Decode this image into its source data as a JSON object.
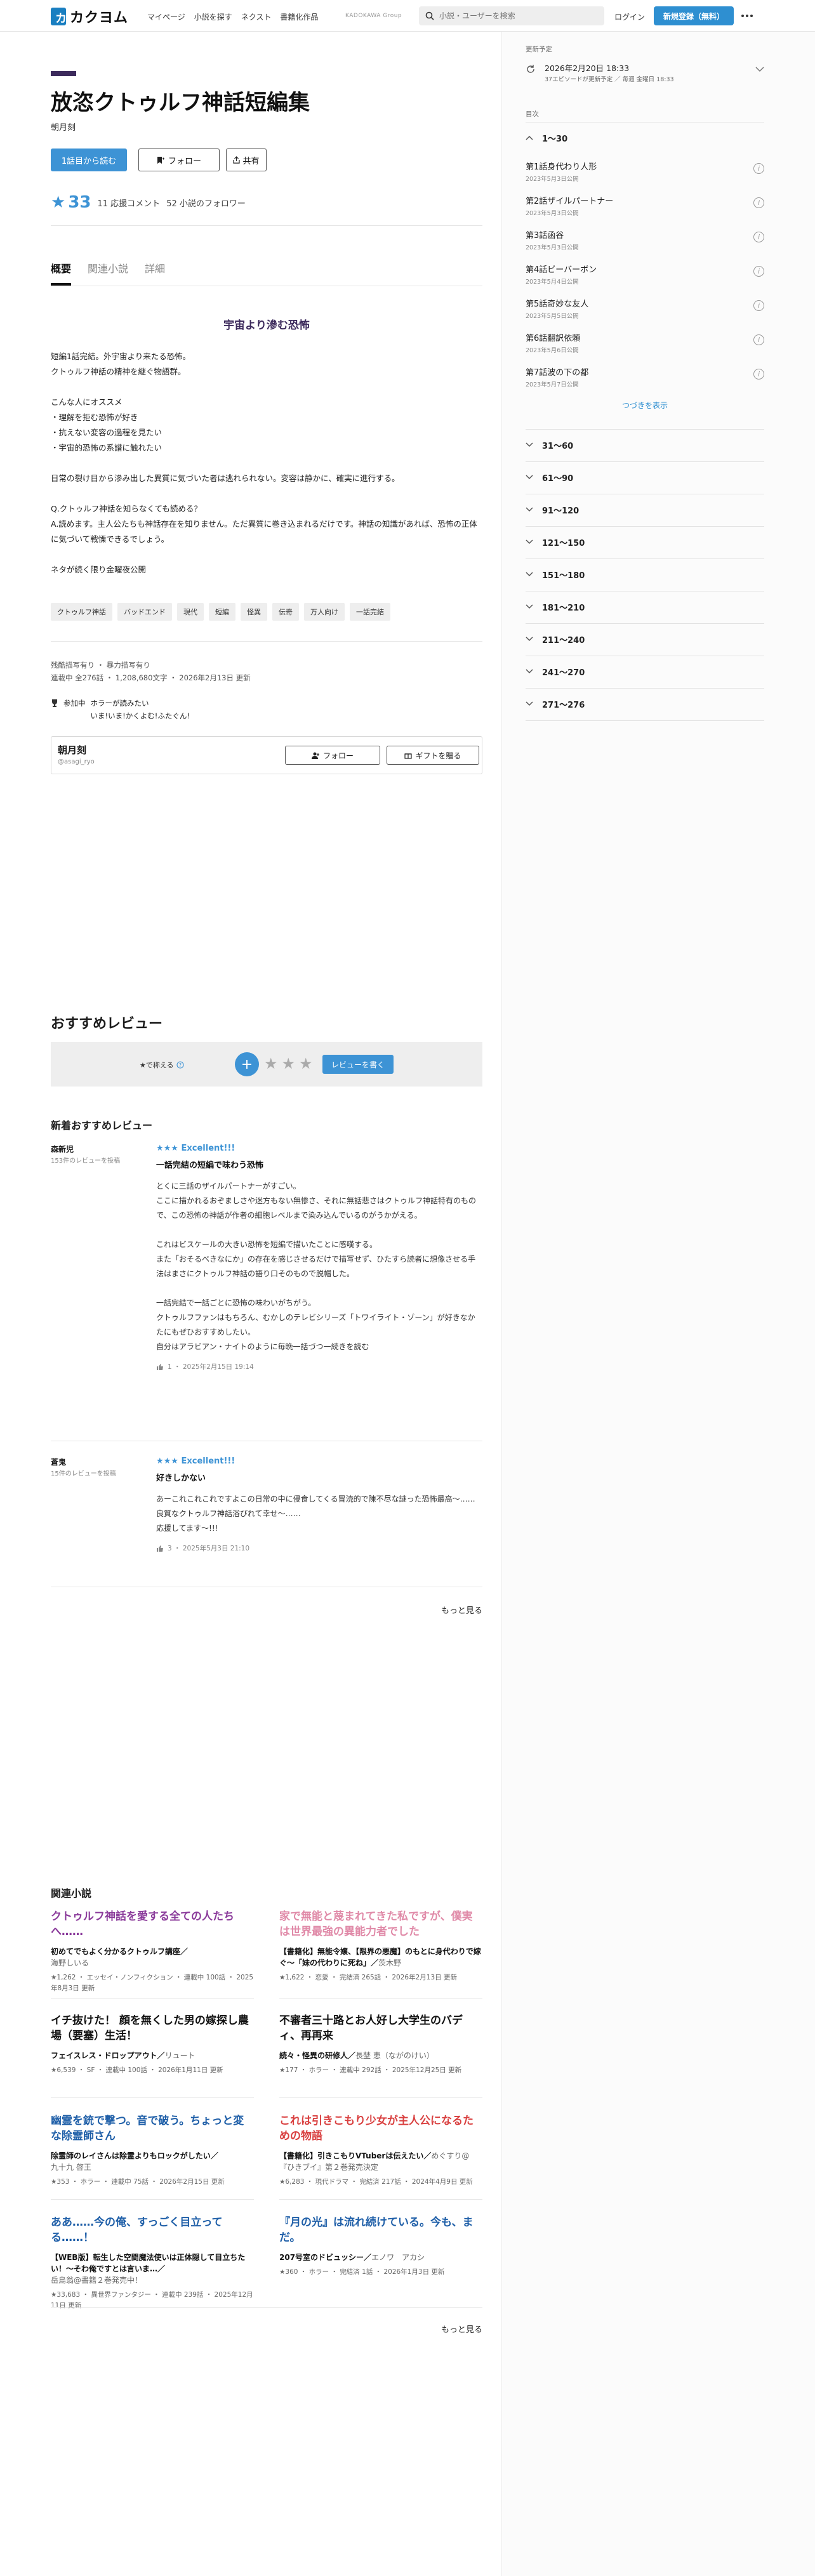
{
  "header": {
    "logo_glyph": "カ",
    "logo_text": "カクヨム",
    "nav": [
      "マイページ",
      "小説を探す",
      "ネクスト",
      "書籍化作品"
    ],
    "powered": "KADOKAWA Group",
    "search_placeholder": "小説・ユーザーを検索",
    "login": "ログイン",
    "signup": "新規登録（無料）"
  },
  "work": {
    "title": "放恣クトゥルフ神話短編集",
    "author": "朝月刻",
    "read_button": "1話目から読む",
    "follow_button": "フォロー",
    "share_button": "共有",
    "stars": "33",
    "cheer_comments": "11 応援コメント",
    "followers": "52 小説のフォロワー",
    "tabs": [
      "概要",
      "関連小説",
      "詳細"
    ],
    "catchphrase": "宇宙より滲む恐怖",
    "intro_paragraphs": [
      "短編1話完結。外宇宙より来たる恐怖。\nクトゥルフ神話の精神を継ぐ物語群。",
      "こんな人にオススメ\n・理解を拒む恐怖が好き\n・抗えない変容の過程を見たい\n・宇宙的恐怖の系譜に触れたい",
      "日常の裂け目から滲み出した異質に気づいた者は逃れられない。変容は静かに、確実に進行する。",
      "Q.クトゥルフ神話を知らなくても読める？\nA.読めます。主人公たちも神話存在を知りません。ただ異質に巻き込まれるだけです。神話の知識があれば、恐怖の正体に気づいて戦慄できるでしょう。",
      "ネタが続く限り金曜夜公開"
    ],
    "tags": [
      "クトゥルフ神話",
      "バッドエンド",
      "現代",
      "短編",
      "怪異",
      "伝奇",
      "万人向け",
      "一話完結"
    ],
    "meta_line1": "残酷描写有り ・ 暴力描写有り",
    "meta_line2": "連載中 全276話 ・ 1,208,680文字 ・ 2026年2月13日 更新",
    "contest_label": "参加中",
    "contest_lines": [
      "ホラーが読みたい",
      "いま!いま!かくよむ!ふたぐん!"
    ],
    "author_card": {
      "name": "朝月刻",
      "id": "@asagi_ryo",
      "follow": "フォロー",
      "gift": "ギフトを贈る"
    }
  },
  "reviews": {
    "section_title": "おすすめレビュー",
    "rate_label": "★で称える",
    "plus": "+",
    "empty_stars": "★★★",
    "write_button": "レビューを書く",
    "new_title": "新着おすすめレビュー",
    "items": [
      {
        "user": "森新児",
        "count": "153件のレビューを投稿",
        "rating": "★★★ Excellent!!!",
        "headline": "一話完結の短編で味わう恐怖",
        "text": "とくに三話のザイルパートナーがすごい。\nここに描かれるおぞましさや迷方もない無惨さ、それに無話悲さはクトゥルフ神話特有のもので、この恐怖の神話が作者の細胞レベルまで染み込んでいるのがうかがえる。\n\nこれはビスケールの大きい恐怖を短編で描いたことに感嘆する。\nまた「おそるべきなにか」の存在を感じさせるだけで描写せず、ひたすら読者に想像させる手法はまさにクトゥルフ神話の語り口そのもので脱帽した。\n\n一話完結で一話ごとに恐怖の味わいがちがう。\nクトゥルフファンはもちろん、むかしのテレビシリーズ「トワイライト・ゾーン」が好きなかたにもぜひおすすめしたい。\n自分はアラビアン・ナイトのように毎晩一話づつ一続きを読む",
        "footer": "1 ・ 2025年2月15日 19:14"
      },
      {
        "user": "蒼鬼",
        "count": "15件のレビューを投稿",
        "rating": "★★★ Excellent!!!",
        "headline": "好きしかない",
        "text": "あーこれこれこれですよこの日常の中に侵食してくる冒涜的で陳不尽な謎った恐怖最高〜……良質なクトゥルフ神話浴びれて幸せ〜……\n応援してます〜!!!",
        "footer": "3 ・ 2025年5月3日 21:10"
      }
    ],
    "more": "もっと見る"
  },
  "related": {
    "section_title": "関連小説",
    "items": [
      {
        "title": "クトゥルフ神話を愛する全ての人たちへ……",
        "color": "#8a3a9a",
        "catch": "初めてでもよく分かるクトゥルフ講座",
        "by": "海野しいる",
        "meta": "★1,262 ・ エッセイ・ノンフィクション ・ 連載中 100話 ・ 2025年8月3日 更新"
      },
      {
        "title": "家で無能と蔑まれてきた私ですが、僕実は世界最強の異能力者でした",
        "color": "#e08aa8",
        "catch": "【書籍化】無能令嬢、【限界の悪魔】のもとに身代わりで嫁ぐ〜「妹の代わりに死ね」",
        "by": "茨木野",
        "meta": "★1,622 ・ 恋愛 ・ 完結済 265話 ・ 2026年2月13日 更新"
      },
      {
        "title": "イチ抜けた！ 顔を無くした男の嫁探し農場（要塞）生活！",
        "color": "#111111",
        "catch": "フェイスレス・ドロップアウト",
        "by": "リュート",
        "meta": "★6,539 ・ SF ・ 連載中 100話 ・ 2026年1月11日 更新"
      },
      {
        "title": "不審者三十路とお人好し大学生のバディ、再再来",
        "color": "#111111",
        "catch": "続々・怪異の研修人",
        "by": "長埜 恵（ながのけい）",
        "meta": "★177 ・ ホラー ・ 連載中 292話 ・ 2025年12月25日 更新"
      },
      {
        "title": "幽霊を銃で撃つ。音で破う。ちょっと変な除霊師さん",
        "color": "#1f5fa8",
        "catch": "除霊師のレイさんは除霊よりもロックがしたい",
        "by": "九十九 啓王",
        "meta": "★353 ・ ホラー ・ 連載中 75話 ・ 2026年2月15日 更新"
      },
      {
        "title": "これは引きこもり少女が主人公になるための物語",
        "color": "#d94040",
        "catch": "【書籍化】引きこもりVTuberは伝えたい",
        "by": "めぐすり@『ひきブイ』第２巻発売決定",
        "meta": "★6,283 ・ 現代ドラマ ・ 完結済 217話 ・ 2024年4月9日 更新"
      },
      {
        "title": "ああ……今の俺、すっごく目立ってる……！",
        "color": "#1f5fa8",
        "catch": "【WEB版】転生した空間魔法使いは正体隠して目立ちたい！〜そわ俺ですとは言いま…",
        "by": "岳鳥翁@書籍２巻発売中！",
        "meta": "★33,683 ・ 異世界ファンタジー ・ 連載中 239話 ・ 2025年12月11日 更新"
      },
      {
        "title": "『月の光』は流れ続けている。今も、まだ。",
        "color": "#1f5fa8",
        "catch": "207号室のドビュッシー",
        "by": "エノワ　アカシ",
        "meta": "★360 ・ ホラー ・ 完結済 1話 ・ 2026年1月3日 更新"
      }
    ],
    "more": "もっと見る"
  },
  "sidebar": {
    "update_label": "更新予定",
    "update_date": "2026年2月20日 18:33",
    "update_schedule": "37エピソードが更新予定 ／ 毎週 金曜日 18:33",
    "toc_label": "目次",
    "open_volume": "1〜30",
    "episodes": [
      {
        "title": "第1話身代わり人形",
        "date": "2023年5月3日公開"
      },
      {
        "title": "第2話ザイルパートナー",
        "date": "2023年5月3日公開"
      },
      {
        "title": "第3話函谷",
        "date": "2023年5月3日公開"
      },
      {
        "title": "第4話ビーバーボン",
        "date": "2023年5月4日公開"
      },
      {
        "title": "第5話奇妙な友人",
        "date": "2023年5月5日公開"
      },
      {
        "title": "第6話翻訳依頼",
        "date": "2023年5月6日公開"
      },
      {
        "title": "第7話波の下の都",
        "date": "2023年5月7日公開"
      }
    ],
    "continue": "つづきを表示",
    "volumes": [
      "31〜60",
      "61〜90",
      "91〜120",
      "121〜150",
      "151〜180",
      "181〜210",
      "211〜240",
      "241〜270",
      "271〜276"
    ]
  }
}
